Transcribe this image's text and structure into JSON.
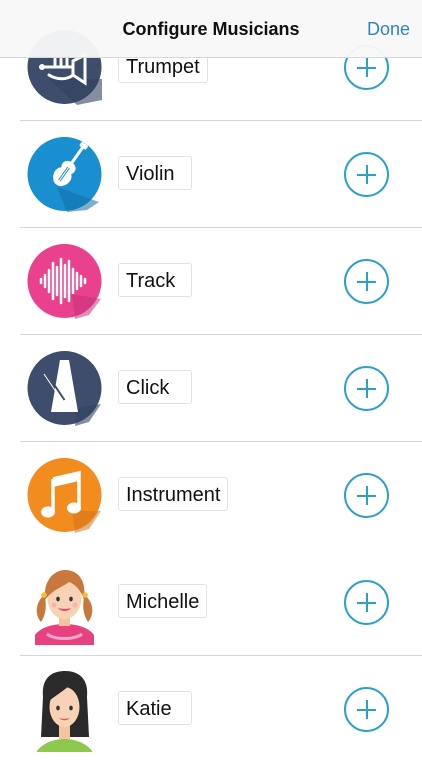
{
  "navbar": {
    "title": "Configure Musicians",
    "done_label": "Done"
  },
  "musicians": [
    {
      "name": "Trumpet",
      "icon": "trumpet-icon",
      "color": "#3d4d6b"
    },
    {
      "name": "Violin",
      "icon": "violin-icon",
      "color": "#1a8fcf"
    },
    {
      "name": "Track",
      "icon": "waveform-icon",
      "color": "#e9418e"
    },
    {
      "name": "Click",
      "icon": "metronome-icon",
      "color": "#3d4d6b"
    },
    {
      "name": "Instrument",
      "icon": "music-note-icon",
      "color": "#f28c1e"
    },
    {
      "name": "Michelle",
      "icon": "avatar-girl-icon",
      "color": "#e8bb96"
    },
    {
      "name": "Katie",
      "icon": "avatar-woman-icon",
      "color": "#2a2a2a"
    }
  ],
  "colors": {
    "accent": "#2aa1c6",
    "done_link": "#2f84c8"
  }
}
